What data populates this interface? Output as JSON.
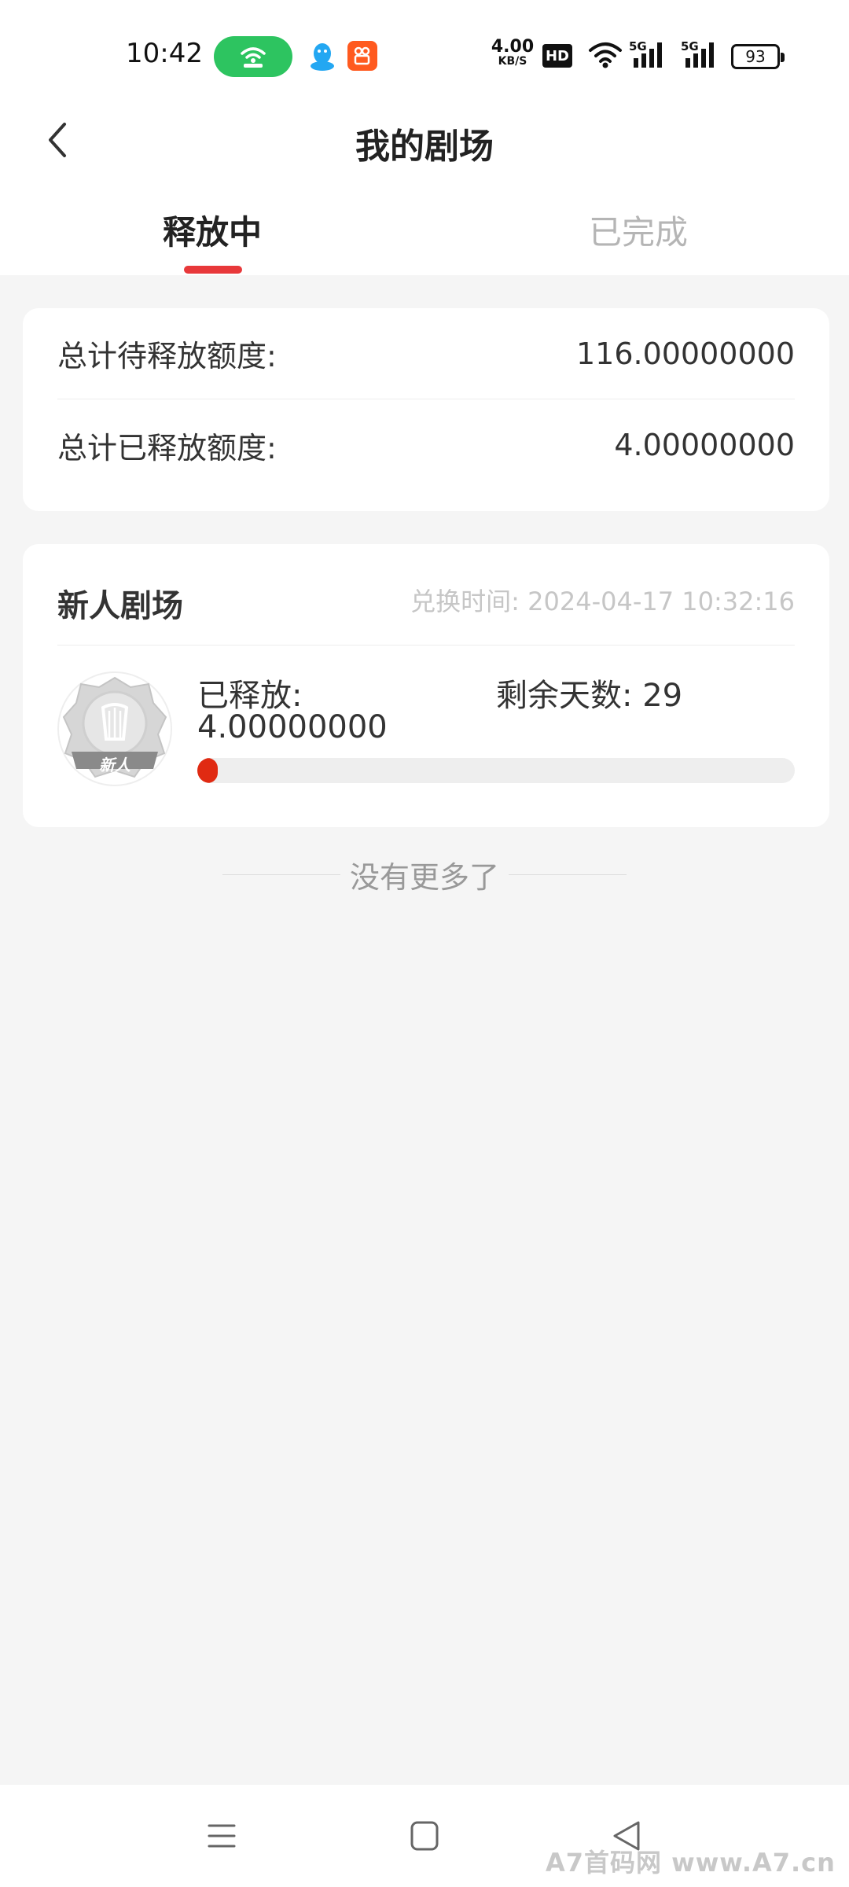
{
  "status_bar": {
    "time": "10:42",
    "net_speed": "4.00",
    "net_speed_unit": "KB/S",
    "hd_label": "HD",
    "sim1": "5G",
    "sim2": "5G",
    "battery": "93",
    "hotspot_color": "#2dc460",
    "app_icon_color": "#ff5a1f"
  },
  "header": {
    "title": "我的剧场"
  },
  "tabs": [
    {
      "label": "释放中",
      "active": true
    },
    {
      "label": "已完成",
      "active": false
    }
  ],
  "summary": {
    "pending_label": "总计待释放额度:",
    "pending_value": "116.00000000",
    "released_label": "总计已释放额度:",
    "released_value": "4.00000000"
  },
  "theater": {
    "title": "新人剧场",
    "exchange_time_label": "兑换时间:",
    "exchange_time": "2024-04-17 10:32:16",
    "exchange_time_full": "兑换时间: 2024-04-17 10:32:16",
    "badge_text": "新人",
    "released_label": "已释放:",
    "released_value": "4.00000000",
    "remaining_days_label": "剩余天数:",
    "remaining_days": "29",
    "remaining_full": "剩余天数:  29",
    "progress_fraction": 0.033
  },
  "list_footer": "没有更多了",
  "nav_bar": {
    "buttons": [
      "menu-icon",
      "home-square-icon",
      "back-triangle-icon"
    ]
  },
  "watermark": "A7首码网   www.A7.cn",
  "colors": {
    "accent": "#e8383a",
    "progress": "#e02a12",
    "background": "#f5f5f5"
  }
}
